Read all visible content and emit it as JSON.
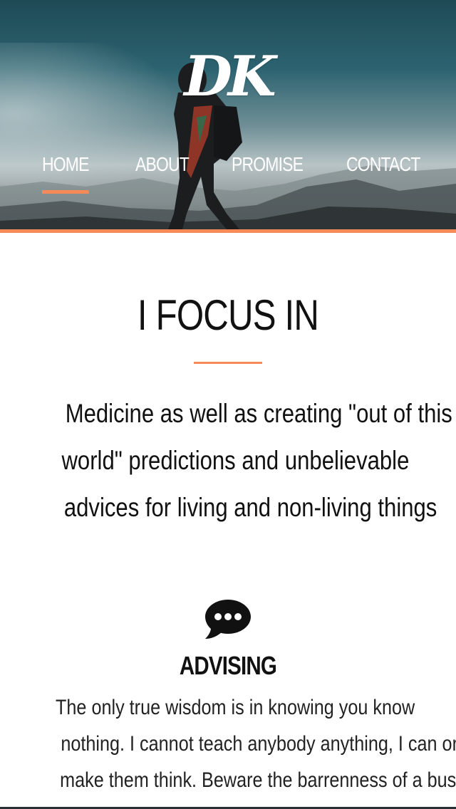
{
  "header": {
    "logo_text": "DK",
    "nav": [
      {
        "label": "HOME",
        "active": true
      },
      {
        "label": "ABOUT",
        "active": false
      },
      {
        "label": "PROMISE",
        "active": false
      },
      {
        "label": "CONTACT",
        "active": false
      }
    ],
    "accent_color": "#f68b57"
  },
  "focus": {
    "title": "I FOCUS IN",
    "description_lines": [
      "Medicine as well as creating \"out of this",
      "world\" predictions and unbelievable",
      "advices for living and non-living things"
    ]
  },
  "advising": {
    "icon": "chat-bubble-icon",
    "title": "ADVISING",
    "text_lines": [
      "The only true wisdom is in knowing you know",
      "nothing. I cannot teach anybody anything, I can only",
      "make them think. Beware the barrenness of a busy"
    ]
  }
}
